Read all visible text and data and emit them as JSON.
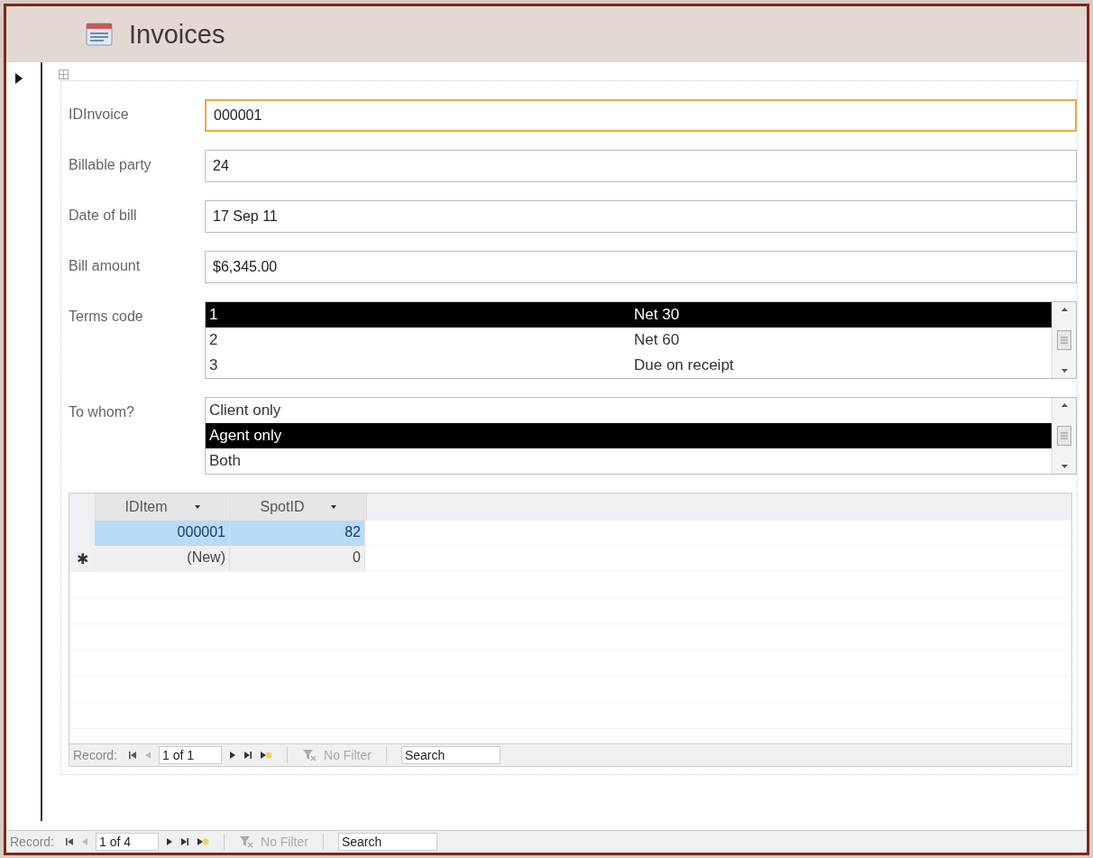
{
  "title": "Invoices",
  "fields": [
    {
      "label": "IDInvoice",
      "value": "000001",
      "focused": true
    },
    {
      "label": "Billable party",
      "value": "24",
      "focused": false
    },
    {
      "label": "Date of bill",
      "value": "17 Sep 11",
      "focused": false
    },
    {
      "label": "Bill amount",
      "value": "$6,345.00",
      "focused": false
    }
  ],
  "terms": {
    "label": "Terms code",
    "rows": [
      {
        "code": "1",
        "description": "Net 30",
        "selected": true
      },
      {
        "code": "2",
        "description": "Net 60",
        "selected": false
      },
      {
        "code": "3",
        "description": "Due on receipt",
        "selected": false
      }
    ]
  },
  "to_whom": {
    "label": "To whom?",
    "options": [
      {
        "text": "Client only",
        "selected": false
      },
      {
        "text": "Agent only",
        "selected": true
      },
      {
        "text": "Both",
        "selected": false
      }
    ]
  },
  "subform": {
    "columns": [
      "IDItem",
      "SpotID"
    ],
    "rows": [
      {
        "kind": "record",
        "cells": [
          "000001",
          "82"
        ],
        "selected": true
      },
      {
        "kind": "new",
        "selector": "✱",
        "cells": [
          "(New)",
          "0"
        ],
        "selected": false
      }
    ],
    "nav": {
      "label": "Record:",
      "position": "1 of 1",
      "filter": "No Filter",
      "placeholder": "Search"
    }
  },
  "nav": {
    "label": "Record:",
    "position": "1 of 4",
    "filter": "No Filter",
    "placeholder": "Search"
  }
}
